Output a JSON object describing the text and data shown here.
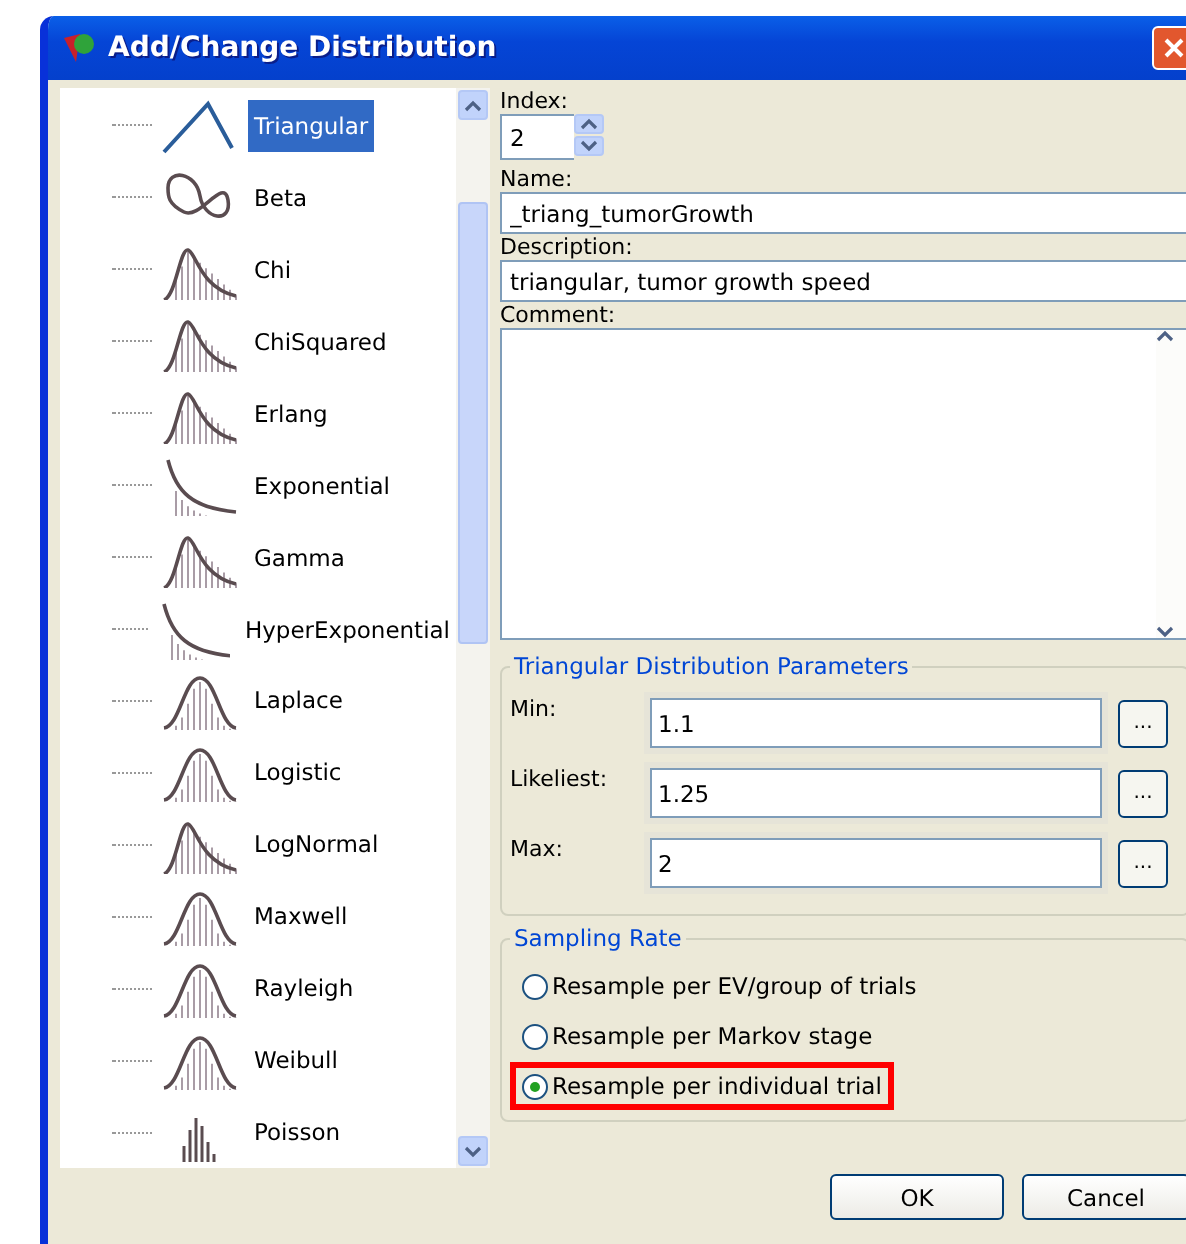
{
  "window": {
    "title": "Add/Change Distribution"
  },
  "distributions": [
    {
      "label": "Triangular",
      "kind": "triangle",
      "selected": true
    },
    {
      "label": "Beta",
      "kind": "loop",
      "selected": false
    },
    {
      "label": "Chi",
      "kind": "skew",
      "selected": false
    },
    {
      "label": "ChiSquared",
      "kind": "skew",
      "selected": false
    },
    {
      "label": "Erlang",
      "kind": "skew",
      "selected": false
    },
    {
      "label": "Exponential",
      "kind": "decay",
      "selected": false
    },
    {
      "label": "Gamma",
      "kind": "skew",
      "selected": false
    },
    {
      "label": "HyperExponential",
      "kind": "decay",
      "selected": false
    },
    {
      "label": "Laplace",
      "kind": "bell",
      "selected": false
    },
    {
      "label": "Logistic",
      "kind": "bell",
      "selected": false
    },
    {
      "label": "LogNormal",
      "kind": "skew",
      "selected": false
    },
    {
      "label": "Maxwell",
      "kind": "bell",
      "selected": false
    },
    {
      "label": "Rayleigh",
      "kind": "bell",
      "selected": false
    },
    {
      "label": "Weibull",
      "kind": "bell",
      "selected": false
    },
    {
      "label": "Poisson",
      "kind": "bars",
      "selected": false
    }
  ],
  "index": {
    "label": "Index:",
    "value": "2"
  },
  "name": {
    "label": "Name:",
    "value": "_triang_tumorGrowth"
  },
  "description": {
    "label": "Description:",
    "value": "triangular, tumor growth speed"
  },
  "comment": {
    "label": "Comment:"
  },
  "parameters": {
    "title": "Triangular Distribution Parameters",
    "rows": [
      {
        "label": "Min:",
        "value": "1.1",
        "button": "..."
      },
      {
        "label": "Likeliest:",
        "value": "1.25",
        "button": "..."
      },
      {
        "label": "Max:",
        "value": "2",
        "button": "..."
      }
    ]
  },
  "sampling": {
    "title": "Sampling Rate",
    "options": [
      {
        "label": "Resample per EV/group of trials",
        "selected": false,
        "highlighted": false
      },
      {
        "label": "Resample per Markov stage",
        "selected": false,
        "highlighted": false
      },
      {
        "label": "Resample per individual trial",
        "selected": true,
        "highlighted": true
      }
    ]
  },
  "buttons": [
    "OK",
    "Cancel"
  ]
}
